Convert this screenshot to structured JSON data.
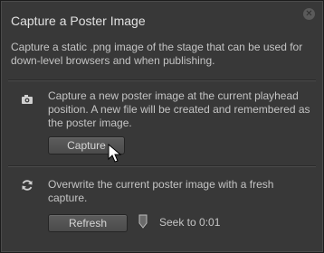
{
  "dialog": {
    "title": "Capture a Poster Image",
    "description": "Capture a static .png image of the stage that can be used for down-level browsers and when publishing."
  },
  "capture_section": {
    "icon": "camera-icon",
    "text": "Capture a new poster image at the current playhead position.  A new file will be created and remembered as the poster image.",
    "button_label": "Capture"
  },
  "refresh_section": {
    "icon": "refresh-icon",
    "text": "Overwrite the current poster image with a fresh capture.",
    "button_label": "Refresh",
    "seek_icon": "playhead-marker-icon",
    "seek_label": "Seek to 0:01"
  }
}
